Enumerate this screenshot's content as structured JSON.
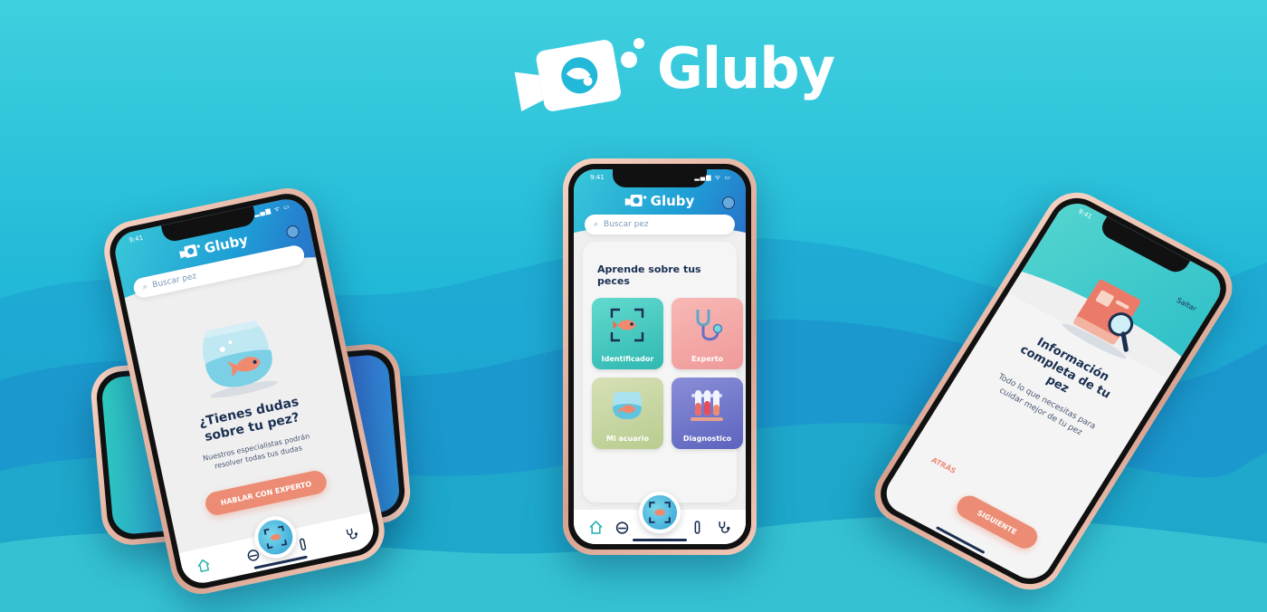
{
  "brand": {
    "name": "Gluby"
  },
  "status": {
    "time": "9:41",
    "icons": "▂▄▆ ᯤ ▭"
  },
  "left_phone": {
    "search_placeholder": "Buscar pez",
    "title": "¿Tienes dudas sobre tu pez?",
    "text": "Nuestros especialistas podrán resolver todas tus dudas",
    "cta_label": "HABLAR CON EXPERTO"
  },
  "center_phone": {
    "search_placeholder": "Buscar pez",
    "section_title": "Aprende sobre tus peces",
    "tiles": [
      {
        "label": "Identificador",
        "color": "#3ecbc2"
      },
      {
        "label": "Experto",
        "color": "#f3a5a4"
      },
      {
        "label": "Mi acuario",
        "color": "#c7d6a3"
      },
      {
        "label": "Diagnostico",
        "color": "#6c74c9"
      }
    ]
  },
  "right_phone": {
    "skip_label": "Saltar",
    "title": "Información completa de tu pez",
    "text": "Todo lo que necesitas para cuidar mejor de tu pez",
    "back_label": "ATRÁS",
    "next_label": "SIGUIENTE"
  },
  "colors": {
    "accent": "#ec8c74",
    "navy": "#1a2f52",
    "teal": "#39c8d8",
    "blue": "#1e9ed6"
  }
}
